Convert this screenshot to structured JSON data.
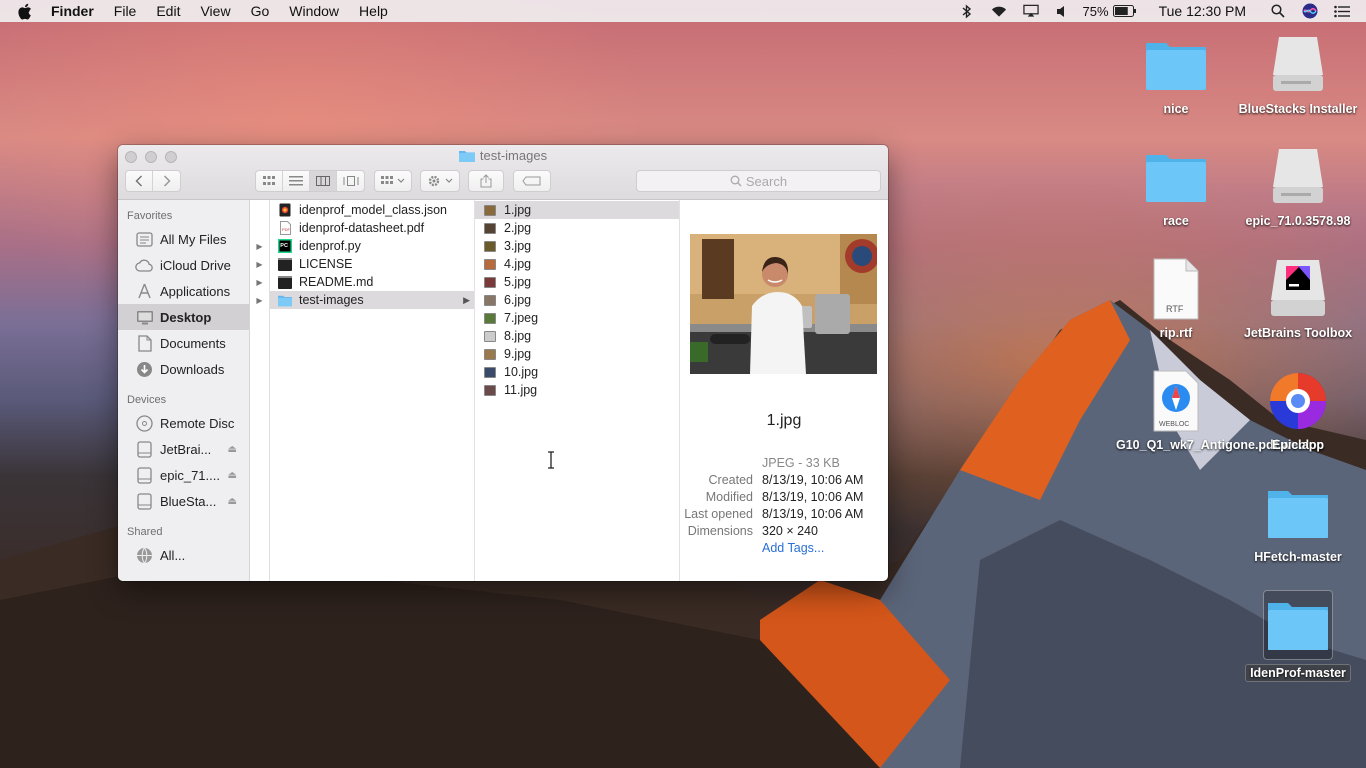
{
  "menubar": {
    "app_name": "Finder",
    "menus": [
      "File",
      "Edit",
      "View",
      "Go",
      "Window",
      "Help"
    ],
    "battery_percent": "75%",
    "clock": "Tue 12:30 PM"
  },
  "window": {
    "title": "test-images",
    "search_placeholder": "Search"
  },
  "sidebar": {
    "favorites_heading": "Favorites",
    "favorites": [
      {
        "label": "All My Files",
        "icon": "all-files-icon"
      },
      {
        "label": "iCloud Drive",
        "icon": "cloud-icon"
      },
      {
        "label": "Applications",
        "icon": "applications-icon"
      },
      {
        "label": "Desktop",
        "icon": "desktop-icon"
      },
      {
        "label": "Documents",
        "icon": "documents-icon"
      },
      {
        "label": "Downloads",
        "icon": "downloads-icon"
      }
    ],
    "devices_heading": "Devices",
    "devices": [
      {
        "label": "Remote Disc",
        "icon": "disc-icon"
      },
      {
        "label": "JetBrai...",
        "icon": "drive-icon"
      },
      {
        "label": "epic_71....",
        "icon": "drive-icon"
      },
      {
        "label": "BlueSta...",
        "icon": "drive-icon"
      }
    ],
    "shared_heading": "Shared",
    "shared": [
      {
        "label": "All...",
        "icon": "network-icon"
      }
    ]
  },
  "column_desktop": [
    {
      "name": "idenprof_model_class.json",
      "icon": "json-icon",
      "expandable": false
    },
    {
      "name": "idenprof-datasheet.pdf",
      "icon": "pdf-icon",
      "expandable": false
    },
    {
      "name": "idenprof.py",
      "icon": "pycharm-file-icon",
      "expandable": true
    },
    {
      "name": "LICENSE",
      "icon": "terminal-file-icon",
      "expandable": true
    },
    {
      "name": "README.md",
      "icon": "terminal-file-icon",
      "expandable": true
    },
    {
      "name": "test-images",
      "icon": "folder-icon",
      "expandable": true
    }
  ],
  "column_test_images": [
    "1.jpg",
    "2.jpg",
    "3.jpg",
    "4.jpg",
    "5.jpg",
    "6.jpg",
    "7.jpeg",
    "8.jpg",
    "9.jpg",
    "10.jpg",
    "11.jpg"
  ],
  "preview": {
    "file_name": "1.jpg",
    "kind": "JPEG - 33 KB",
    "created_label": "Created",
    "created": "8/13/19, 10:06 AM",
    "modified_label": "Modified",
    "modified": "8/13/19, 10:06 AM",
    "last_opened_label": "Last opened",
    "last_opened": "8/13/19, 10:06 AM",
    "dimensions_label": "Dimensions",
    "dimensions": "320 × 240",
    "add_tags": "Add Tags..."
  },
  "desktop_icons": [
    {
      "label": "nice",
      "icon": "folder-icon"
    },
    {
      "label": "BlueStacks Installer",
      "icon": "disk-image-icon"
    },
    {
      "label": "race",
      "icon": "folder-icon"
    },
    {
      "label": "epic_71.0.3578.98",
      "icon": "disk-image-icon"
    },
    {
      "label": "rip.rtf",
      "icon": "rtf-document-icon",
      "badge": "RTF"
    },
    {
      "label": "JetBrains Toolbox",
      "icon": "jetbrains-toolbox-disk-icon"
    },
    {
      "label": "G10_Q1_wk7_Antigone.pdf.webloc",
      "icon": "webloc-icon",
      "badge": "WEBLOC"
    },
    {
      "label": "Epic.app",
      "icon": "epic-browser-icon"
    },
    {
      "label": "HFetch-master",
      "icon": "folder-icon"
    },
    {
      "label": "IdenProf-master",
      "icon": "folder-icon"
    }
  ]
}
